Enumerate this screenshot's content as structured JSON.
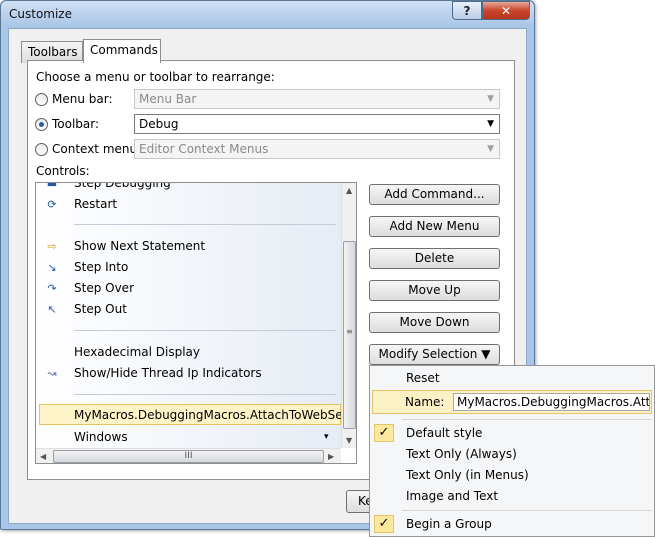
{
  "window": {
    "title": "Customize",
    "help_label": "?",
    "close_label": "✕"
  },
  "tabs": [
    {
      "label": "Toolbars"
    },
    {
      "label": "Commands"
    }
  ],
  "prompt": "Choose a menu or toolbar to rearrange:",
  "options": {
    "menu_bar": {
      "label": "Menu bar:",
      "value": "Menu Bar"
    },
    "toolbar": {
      "label": "Toolbar:",
      "value": "Debug"
    },
    "context_menu": {
      "label": "Context menu:",
      "value": "Editor Context Menus"
    }
  },
  "controls_label": "Controls:",
  "controls": [
    {
      "label": "Step Debugging",
      "icon": "step-debugging-icon"
    },
    {
      "label": "Restart",
      "icon": "restart-icon"
    },
    {
      "label": "Show Next Statement",
      "icon": "show-next-statement-icon"
    },
    {
      "label": "Step Into",
      "icon": "step-into-icon"
    },
    {
      "label": "Step Over",
      "icon": "step-over-icon"
    },
    {
      "label": "Step Out",
      "icon": "step-out-icon"
    },
    {
      "label": "Hexadecimal Display",
      "icon": ""
    },
    {
      "label": "Show/Hide Thread Ip Indicators",
      "icon": "thread-indicators-icon"
    },
    {
      "label": "MyMacros.DebuggingMacros.AttachToWebServer",
      "icon": ""
    },
    {
      "label": "Windows",
      "icon": ""
    }
  ],
  "windows_arrow": "▾",
  "buttons": {
    "add_command": "Add Command...",
    "add_new_menu": "Add New Menu",
    "delete": "Delete",
    "move_up": "Move Up",
    "move_down": "Move Down",
    "modify_selection": "Modify Selection ▼",
    "keyboard_partial": "Ke"
  },
  "scroll_grip": "III",
  "menu": {
    "reset": "Reset",
    "name_label": "Name:",
    "name_value": "MyMacros.DebuggingMacros.Attach",
    "default_style": "Default style",
    "text_only_always": "Text Only (Always)",
    "text_only_menus": "Text Only (in Menus)",
    "image_and_text": "Image and Text",
    "begin_group": "Begin a Group",
    "check_glyph": "✓"
  }
}
